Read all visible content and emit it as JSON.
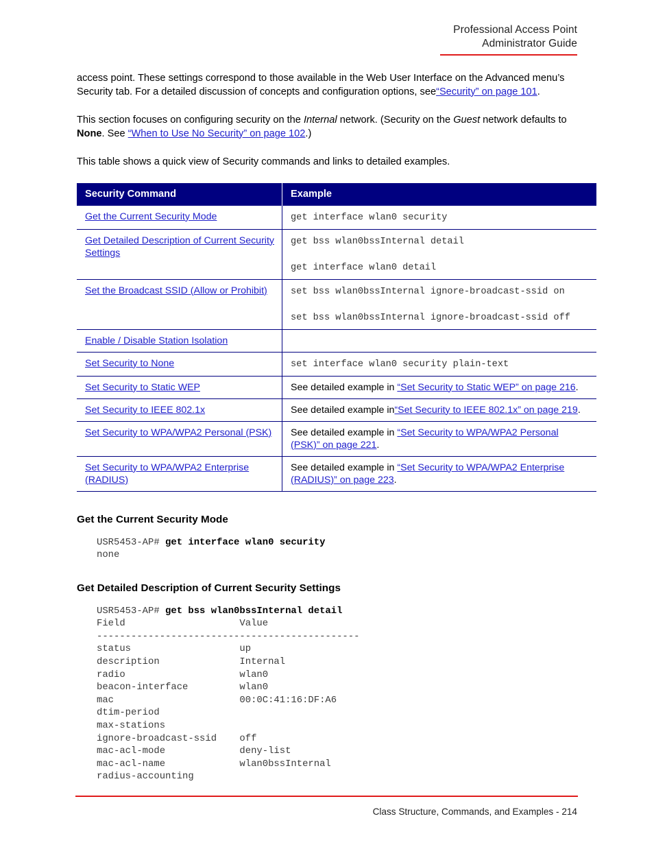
{
  "header": {
    "line1": "Professional Access Point",
    "line2": "Administrator Guide",
    "rule_color": "#e01b1b"
  },
  "body": {
    "para1_a": "access point. These settings correspond to those available in the Web User Interface on the Advanced menu’s Security tab. For a detailed discussion of concepts and configuration options, see",
    "para1_link": "“Security” on page 101",
    "para1_b": ".",
    "para2_a": "This section focuses on configuring security on the ",
    "para2_ital1": "Internal",
    "para2_b": " network. (Security on the ",
    "para2_ital2": "Guest",
    "para2_c": " network defaults to ",
    "para2_bold": "None",
    "para2_d": ". See ",
    "para2_link": "“When to Use No Security” on page 102",
    "para2_e": ".)",
    "para3": "This table shows a quick view of Security commands and links to detailed examples."
  },
  "table": {
    "headers": [
      "Security Command",
      "Example"
    ],
    "header_bg": "#000080",
    "border_color": "#000080",
    "link_color": "#2222cc",
    "rows": [
      {
        "command": "Get the Current Security Mode",
        "example_mono_1": "get interface wlan0 security",
        "example_mono_2": ""
      },
      {
        "command": "Get Detailed Description of Current Security Settings",
        "example_mono_1": "get bss wlan0bssInternal detail",
        "example_mono_2": "get interface wlan0 detail"
      },
      {
        "command": "Set the Broadcast SSID (Allow or Prohibit)",
        "example_mono_1": "set bss wlan0bssInternal ignore-broadcast-ssid on",
        "example_mono_2": "set bss wlan0bssInternal ignore-broadcast-ssid off"
      },
      {
        "command": "Enable / Disable Station Isolation",
        "example_mono_1": "",
        "example_mono_2": ""
      },
      {
        "command": "Set Security to None",
        "example_mono_1": "set interface wlan0 security plain-text",
        "example_mono_2": ""
      },
      {
        "command": "Set Security to Static WEP",
        "example_prefix": "See detailed example in ",
        "example_link": "“Set Security to Static WEP” on page 216",
        "example_suffix": "."
      },
      {
        "command": "Set Security to IEEE 802.1x",
        "example_prefix": "See detailed example in",
        "example_link": "“Set Security to IEEE 802.1x” on page 219",
        "example_suffix": "."
      },
      {
        "command": "Set Security to WPA/WPA2 Personal (PSK)",
        "example_prefix": "See detailed example in ",
        "example_link": "“Set Security to WPA/WPA2 Personal (PSK)” on page 221",
        "example_suffix": "."
      },
      {
        "command": "Set Security to WPA/WPA2 Enterprise (RADIUS)",
        "example_prefix": "See detailed example in ",
        "example_link": "“Set Security to WPA/WPA2 Enterprise (RADIUS)” on page 223",
        "example_suffix": "."
      }
    ]
  },
  "sections": [
    {
      "heading": "Get the Current Security Mode",
      "prompt": "USR5453-AP# ",
      "command": "get interface wlan0 security",
      "output": "none"
    },
    {
      "heading": "Get Detailed Description of Current Security Settings",
      "prompt": "USR5453-AP# ",
      "command": "get bss wlan0bssInternal detail",
      "output": "Field                    Value\n----------------------------------------------\nstatus                   up\ndescription              Internal\nradio                    wlan0\nbeacon-interface         wlan0\nmac                      00:0C:41:16:DF:A6\ndtim-period\nmax-stations\nignore-broadcast-ssid    off\nmac-acl-mode             deny-list\nmac-acl-name             wlan0bssInternal\nradius-accounting"
    }
  ],
  "footer": {
    "text": "Class Structure, Commands, and Examples - 214",
    "rule_color": "#e01b1b"
  }
}
